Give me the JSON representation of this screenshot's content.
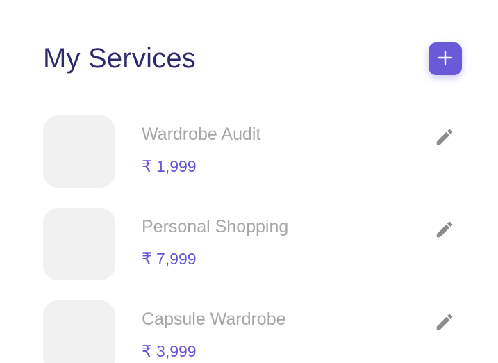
{
  "header": {
    "title": "My Services",
    "add_icon": "plus-icon"
  },
  "services": [
    {
      "name": "Wardrobe Audit",
      "price": "₹ 1,999",
      "edit_icon": "pencil-icon"
    },
    {
      "name": "Personal Shopping",
      "price": "₹ 7,999",
      "edit_icon": "pencil-icon"
    },
    {
      "name": "Capsule Wardrobe",
      "price": "₹ 3,999",
      "edit_icon": "pencil-icon"
    }
  ],
  "colors": {
    "title": "#2e2a6b",
    "accent": "#6b5ad8",
    "price": "#6656d6",
    "name": "#a6a6a6",
    "thumbnail": "#f1f1f1",
    "icon": "#8c8c8c"
  }
}
